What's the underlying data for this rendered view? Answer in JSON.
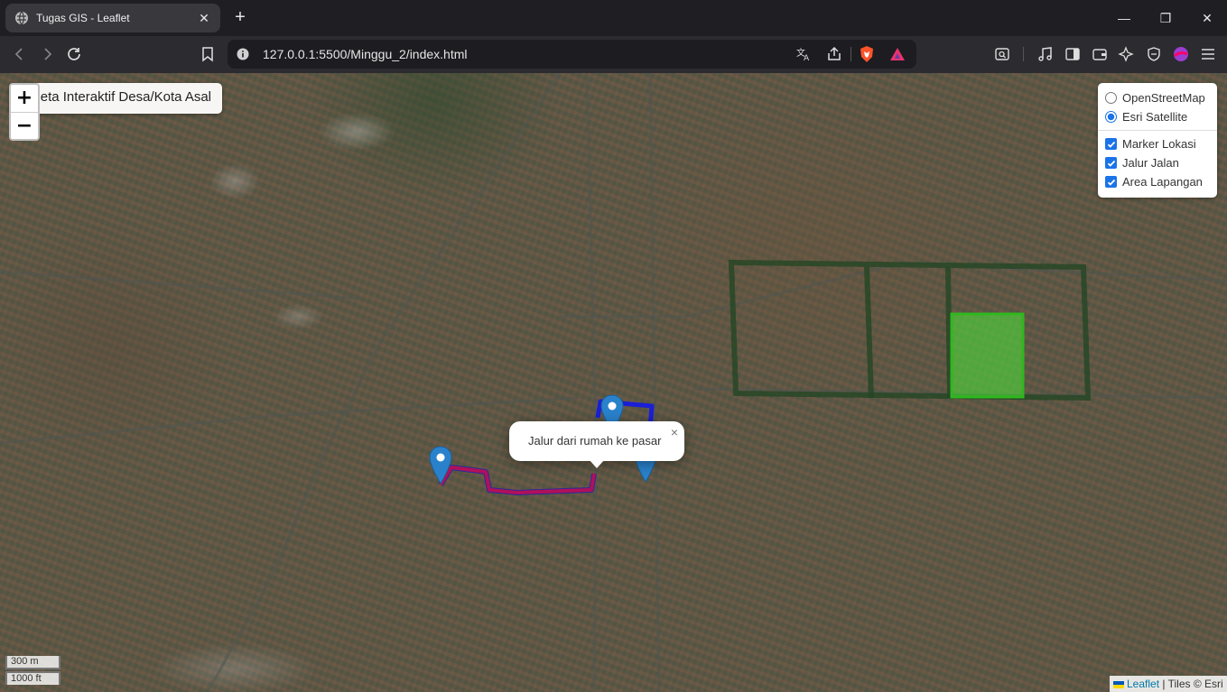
{
  "browser": {
    "tab_title": "Tugas GIS - Leaflet",
    "url": "127.0.0.1:5500/Minggu_2/index.html"
  },
  "map": {
    "title": "Peta Interaktif Desa/Kota Asal",
    "zoom_in": "+",
    "zoom_out": "−",
    "base_layers": [
      {
        "label": "OpenStreetMap",
        "selected": false
      },
      {
        "label": "Esri Satellite",
        "selected": true
      }
    ],
    "overlays": [
      {
        "label": "Marker Lokasi",
        "checked": true
      },
      {
        "label": "Jalur Jalan",
        "checked": true
      },
      {
        "label": "Area Lapangan",
        "checked": true
      }
    ],
    "popup_text": "Jalur dari rumah ke pasar",
    "popup_close": "×",
    "scale_metric": "300 m",
    "scale_imperial": "1000 ft",
    "attribution_link": "Leaflet",
    "attribution_text": " | Tiles © Esri",
    "colors": {
      "route_red": "#b0105a",
      "route_blue": "#1a1fd6",
      "area_fill": "#4fd13a",
      "area_stroke": "#2fb81e",
      "marker": "#2a81cb"
    }
  }
}
